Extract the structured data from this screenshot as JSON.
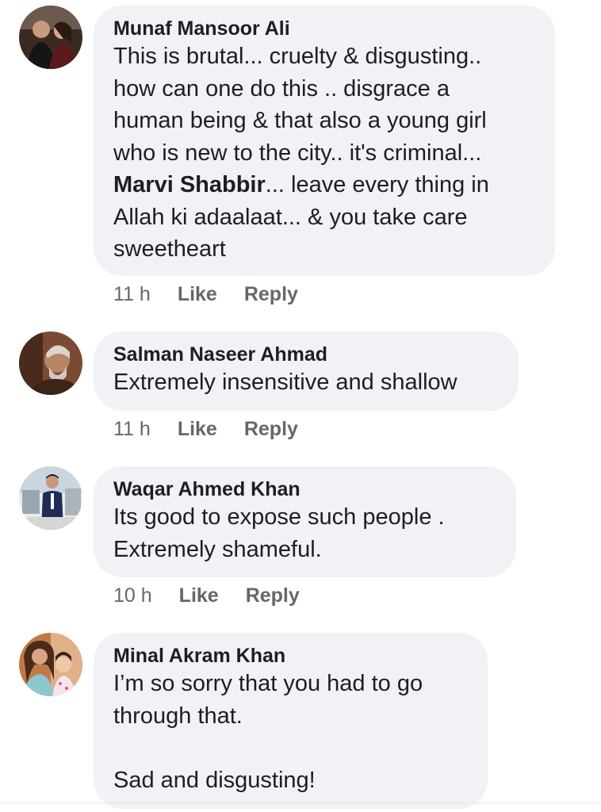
{
  "comments": [
    {
      "author": "Munaf Mansoor Ali",
      "text_pre": "This is brutal... cruelty & disgusting..\nhow can one do this .. disgrace a\nhuman being & that also a young girl\nwho is new to the city.. it's criminal...\n",
      "mention": "Marvi Shabbir",
      "text_post": "... leave every thing in\nAllah ki adaalaat... & you take care\nsweetheart",
      "time": "11 h",
      "like": "Like",
      "reply": "Reply",
      "avatar_icon": "profile-photo-icon"
    },
    {
      "author": "Salman Naseer Ahmad",
      "text": "Extremely insensitive and shallow",
      "time": "11 h",
      "like": "Like",
      "reply": "Reply",
      "avatar_icon": "profile-photo-icon"
    },
    {
      "author": "Waqar Ahmed Khan",
      "text": "Its  good to expose such people .\nExtremely shameful.",
      "time": "10 h",
      "like": "Like",
      "reply": "Reply",
      "avatar_icon": "profile-photo-icon"
    },
    {
      "author": "Minal Akram Khan",
      "text": "I’m so sorry that you had to go\nthrough that.\n\nSad and disgusting!",
      "avatar_icon": "profile-photo-icon"
    }
  ],
  "colors": {
    "bubble": "#f0f2f5",
    "text": "#1c1e21",
    "meta": "#65676b"
  }
}
